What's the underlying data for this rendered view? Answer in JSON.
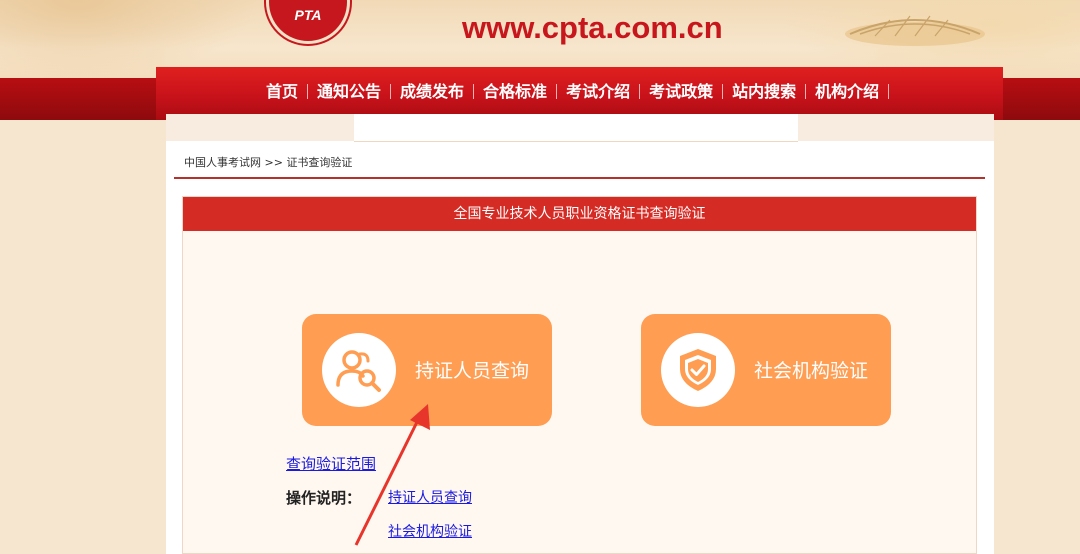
{
  "header": {
    "logo_text": "PTA",
    "site_url": "www.cpta.com.cn"
  },
  "nav": {
    "items": [
      {
        "label": "首页"
      },
      {
        "label": "通知公告"
      },
      {
        "label": "成绩发布"
      },
      {
        "label": "合格标准"
      },
      {
        "label": "考试介绍"
      },
      {
        "label": "考试政策"
      },
      {
        "label": "站内搜索"
      },
      {
        "label": "机构介绍"
      }
    ]
  },
  "breadcrumb": {
    "home": "中国人事考试网",
    "separator": ">>",
    "current": "证书查询验证"
  },
  "panel": {
    "title": "全国专业技术人员职业资格证书查询验证",
    "cards": [
      {
        "label": "持证人员查询",
        "icon": "people-search-icon"
      },
      {
        "label": "社会机构验证",
        "icon": "shield-check-icon"
      }
    ],
    "scope_link": "查询验证范围",
    "ops_label": "操作说明：",
    "op_links": [
      "持证人员查询",
      "社会机构验证"
    ]
  },
  "colors": {
    "nav_red": "#d41b1b",
    "card_orange": "#ff9d52",
    "panel_head": "#d52b25",
    "link_blue": "#1a1ae0",
    "arrow_red": "#e8352c"
  }
}
